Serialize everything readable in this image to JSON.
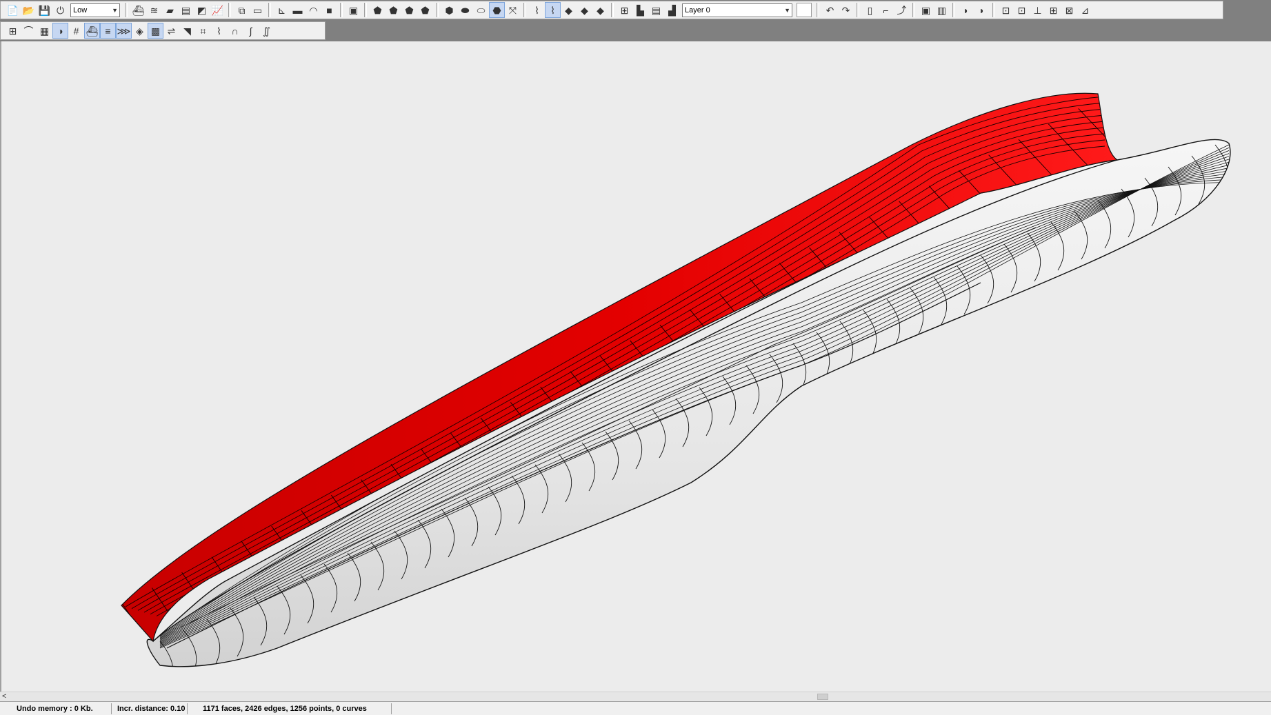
{
  "toolbar": {
    "row1": [
      {
        "type": "button",
        "name": "new-file-icon",
        "glyph": "📄"
      },
      {
        "type": "button",
        "name": "open-folder-icon",
        "glyph": "📂"
      },
      {
        "type": "button",
        "name": "save-icon",
        "glyph": "💾"
      },
      {
        "type": "button",
        "name": "exit-icon",
        "glyph": "⏻"
      },
      {
        "type": "combo",
        "name": "precision-select",
        "value": "Low",
        "width": 72
      },
      {
        "type": "sep"
      },
      {
        "type": "button",
        "name": "design-hydrostatics-icon",
        "glyph": "⛴"
      },
      {
        "type": "button",
        "name": "crosscurves-icon",
        "glyph": "≋"
      },
      {
        "type": "button",
        "name": "resistance-icon",
        "glyph": "▰"
      },
      {
        "type": "button",
        "name": "calculate-icon",
        "glyph": "▤"
      },
      {
        "type": "button",
        "name": "hull-stability-icon",
        "glyph": "◩"
      },
      {
        "type": "button",
        "name": "graph-icon",
        "glyph": "📈"
      },
      {
        "type": "sep"
      },
      {
        "type": "button",
        "name": "zoom-extents-icon",
        "glyph": "⧉"
      },
      {
        "type": "button",
        "name": "window-icon",
        "glyph": "▭"
      },
      {
        "type": "sep"
      },
      {
        "type": "button",
        "name": "axes-icon",
        "glyph": "⊾"
      },
      {
        "type": "button",
        "name": "ship-profile-icon",
        "glyph": "▬"
      },
      {
        "type": "button",
        "name": "bow-icon",
        "glyph": "◠"
      },
      {
        "type": "button",
        "name": "color-icon",
        "glyph": "■"
      },
      {
        "type": "sep"
      },
      {
        "type": "button",
        "name": "import-icon",
        "glyph": "▣"
      },
      {
        "type": "sep"
      },
      {
        "type": "button",
        "name": "surface-1-icon",
        "glyph": "⬟"
      },
      {
        "type": "button",
        "name": "surface-2-icon",
        "glyph": "⬟"
      },
      {
        "type": "button",
        "name": "surface-3-icon",
        "glyph": "⬟"
      },
      {
        "type": "button",
        "name": "surface-4-icon",
        "glyph": "⬟"
      },
      {
        "type": "sep"
      },
      {
        "type": "button",
        "name": "view-body-plan-icon",
        "glyph": "⬢"
      },
      {
        "type": "button",
        "name": "view-profile-icon",
        "glyph": "⬬"
      },
      {
        "type": "button",
        "name": "view-plan-icon",
        "glyph": "⬭"
      },
      {
        "type": "button",
        "name": "view-perspective-icon",
        "glyph": "⬣",
        "active": true
      },
      {
        "type": "button",
        "name": "zoom-fit-icon",
        "glyph": "⤧"
      },
      {
        "type": "sep"
      },
      {
        "type": "button",
        "name": "wireframe-icon",
        "glyph": "⌇"
      },
      {
        "type": "button",
        "name": "flat-shade-icon",
        "glyph": "⌇",
        "active": true
      },
      {
        "type": "button",
        "name": "gauss-curvature-icon",
        "glyph": "◆"
      },
      {
        "type": "button",
        "name": "zebra-icon",
        "glyph": "◆"
      },
      {
        "type": "button",
        "name": "developable-icon",
        "glyph": "◆"
      },
      {
        "type": "sep"
      },
      {
        "type": "button",
        "name": "new-layer-icon",
        "glyph": "⊞"
      },
      {
        "type": "button",
        "name": "layer-props-icon",
        "glyph": "▙"
      },
      {
        "type": "button",
        "name": "layer-list-icon",
        "glyph": "▤"
      },
      {
        "type": "button",
        "name": "layer-delete-icon",
        "glyph": "▟"
      },
      {
        "type": "combo",
        "name": "layer-select",
        "value": "Layer 0",
        "width": 160
      },
      {
        "type": "blank",
        "name": "layer-color-swatch"
      },
      {
        "type": "sep"
      },
      {
        "type": "button",
        "name": "undo-icon",
        "glyph": "↶"
      },
      {
        "type": "button",
        "name": "redo-icon",
        "glyph": "↷"
      },
      {
        "type": "sep"
      },
      {
        "type": "button",
        "name": "point-new-icon",
        "glyph": "▯"
      },
      {
        "type": "button",
        "name": "edge-extrude-icon",
        "glyph": "⌐"
      },
      {
        "type": "button",
        "name": "edge-split-icon",
        "glyph": "⤴"
      },
      {
        "type": "sep"
      },
      {
        "type": "button",
        "name": "face-new-icon",
        "glyph": "▣"
      },
      {
        "type": "button",
        "name": "face-flip-icon",
        "glyph": "▥"
      },
      {
        "type": "sep"
      },
      {
        "type": "button",
        "name": "lines-blue-icon",
        "glyph": "◗"
      },
      {
        "type": "button",
        "name": "lines-blue-2-icon",
        "glyph": "◗"
      },
      {
        "type": "sep"
      },
      {
        "type": "button",
        "name": "mirror-icon",
        "glyph": "⊡"
      },
      {
        "type": "button",
        "name": "rotate-icon",
        "glyph": "⊡"
      },
      {
        "type": "button",
        "name": "move-icon",
        "glyph": "⊥"
      },
      {
        "type": "button",
        "name": "grid-move-icon",
        "glyph": "⊞"
      },
      {
        "type": "button",
        "name": "scale-icon",
        "glyph": "⊠"
      },
      {
        "type": "button",
        "name": "transform-icon",
        "glyph": "⊿"
      }
    ],
    "row2": [
      {
        "type": "button",
        "name": "control-net-icon",
        "glyph": "⊞"
      },
      {
        "type": "button",
        "name": "interior-edges-icon",
        "glyph": "⌒"
      },
      {
        "type": "button",
        "name": "grid-icon",
        "glyph": "▦"
      },
      {
        "type": "button",
        "name": "shade-icon",
        "glyph": "◑",
        "active": true
      },
      {
        "type": "button",
        "name": "stations-icon",
        "glyph": "#"
      },
      {
        "type": "button",
        "name": "buttocks-icon",
        "glyph": "⛴",
        "active": true
      },
      {
        "type": "button",
        "name": "waterlines-icon",
        "glyph": "≡",
        "active": true
      },
      {
        "type": "button",
        "name": "diagonals-icon",
        "glyph": "⋙",
        "active": true
      },
      {
        "type": "button",
        "name": "normals-icon",
        "glyph": "◈"
      },
      {
        "type": "button",
        "name": "calc-icon",
        "glyph": "▩",
        "active": true
      },
      {
        "type": "button",
        "name": "hydrostatic-icon",
        "glyph": "⇌"
      },
      {
        "type": "button",
        "name": "flowlines-icon",
        "glyph": "◥"
      },
      {
        "type": "button",
        "name": "markers-icon",
        "glyph": "⌗"
      },
      {
        "type": "button",
        "name": "curvature-icon",
        "glyph": "⌇"
      },
      {
        "type": "button",
        "name": "curves-icon",
        "glyph": "∩"
      },
      {
        "type": "button",
        "name": "spline-icon",
        "glyph": "∫"
      },
      {
        "type": "button",
        "name": "spline-2-icon",
        "glyph": "∬"
      }
    ]
  },
  "colors": {
    "hull_red": "#e30000",
    "hull_white": "#f4f4f4",
    "edge": "#111111",
    "background": "#ececec"
  },
  "status": {
    "undo_memory": "Undo memory : 0 Kb.",
    "incr_distance": "Incr. distance: 0.10",
    "model_stats": "1171 faces, 2426 edges, 1256 points, 0 curves"
  },
  "scrollbar": {
    "left_arrow": "<"
  }
}
